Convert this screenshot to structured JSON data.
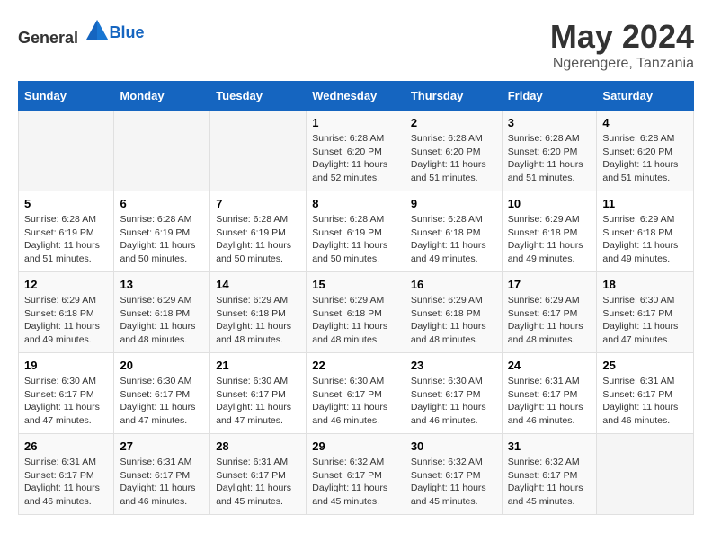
{
  "header": {
    "logo_general": "General",
    "logo_blue": "Blue",
    "title": "May 2024",
    "subtitle": "Ngerengere, Tanzania"
  },
  "days_of_week": [
    "Sunday",
    "Monday",
    "Tuesday",
    "Wednesday",
    "Thursday",
    "Friday",
    "Saturday"
  ],
  "weeks": [
    [
      {
        "day": "",
        "info": ""
      },
      {
        "day": "",
        "info": ""
      },
      {
        "day": "",
        "info": ""
      },
      {
        "day": "1",
        "info": "Sunrise: 6:28 AM\nSunset: 6:20 PM\nDaylight: 11 hours and 52 minutes."
      },
      {
        "day": "2",
        "info": "Sunrise: 6:28 AM\nSunset: 6:20 PM\nDaylight: 11 hours and 51 minutes."
      },
      {
        "day": "3",
        "info": "Sunrise: 6:28 AM\nSunset: 6:20 PM\nDaylight: 11 hours and 51 minutes."
      },
      {
        "day": "4",
        "info": "Sunrise: 6:28 AM\nSunset: 6:20 PM\nDaylight: 11 hours and 51 minutes."
      }
    ],
    [
      {
        "day": "5",
        "info": "Sunrise: 6:28 AM\nSunset: 6:19 PM\nDaylight: 11 hours and 51 minutes."
      },
      {
        "day": "6",
        "info": "Sunrise: 6:28 AM\nSunset: 6:19 PM\nDaylight: 11 hours and 50 minutes."
      },
      {
        "day": "7",
        "info": "Sunrise: 6:28 AM\nSunset: 6:19 PM\nDaylight: 11 hours and 50 minutes."
      },
      {
        "day": "8",
        "info": "Sunrise: 6:28 AM\nSunset: 6:19 PM\nDaylight: 11 hours and 50 minutes."
      },
      {
        "day": "9",
        "info": "Sunrise: 6:28 AM\nSunset: 6:18 PM\nDaylight: 11 hours and 49 minutes."
      },
      {
        "day": "10",
        "info": "Sunrise: 6:29 AM\nSunset: 6:18 PM\nDaylight: 11 hours and 49 minutes."
      },
      {
        "day": "11",
        "info": "Sunrise: 6:29 AM\nSunset: 6:18 PM\nDaylight: 11 hours and 49 minutes."
      }
    ],
    [
      {
        "day": "12",
        "info": "Sunrise: 6:29 AM\nSunset: 6:18 PM\nDaylight: 11 hours and 49 minutes."
      },
      {
        "day": "13",
        "info": "Sunrise: 6:29 AM\nSunset: 6:18 PM\nDaylight: 11 hours and 48 minutes."
      },
      {
        "day": "14",
        "info": "Sunrise: 6:29 AM\nSunset: 6:18 PM\nDaylight: 11 hours and 48 minutes."
      },
      {
        "day": "15",
        "info": "Sunrise: 6:29 AM\nSunset: 6:18 PM\nDaylight: 11 hours and 48 minutes."
      },
      {
        "day": "16",
        "info": "Sunrise: 6:29 AM\nSunset: 6:18 PM\nDaylight: 11 hours and 48 minutes."
      },
      {
        "day": "17",
        "info": "Sunrise: 6:29 AM\nSunset: 6:17 PM\nDaylight: 11 hours and 48 minutes."
      },
      {
        "day": "18",
        "info": "Sunrise: 6:30 AM\nSunset: 6:17 PM\nDaylight: 11 hours and 47 minutes."
      }
    ],
    [
      {
        "day": "19",
        "info": "Sunrise: 6:30 AM\nSunset: 6:17 PM\nDaylight: 11 hours and 47 minutes."
      },
      {
        "day": "20",
        "info": "Sunrise: 6:30 AM\nSunset: 6:17 PM\nDaylight: 11 hours and 47 minutes."
      },
      {
        "day": "21",
        "info": "Sunrise: 6:30 AM\nSunset: 6:17 PM\nDaylight: 11 hours and 47 minutes."
      },
      {
        "day": "22",
        "info": "Sunrise: 6:30 AM\nSunset: 6:17 PM\nDaylight: 11 hours and 46 minutes."
      },
      {
        "day": "23",
        "info": "Sunrise: 6:30 AM\nSunset: 6:17 PM\nDaylight: 11 hours and 46 minutes."
      },
      {
        "day": "24",
        "info": "Sunrise: 6:31 AM\nSunset: 6:17 PM\nDaylight: 11 hours and 46 minutes."
      },
      {
        "day": "25",
        "info": "Sunrise: 6:31 AM\nSunset: 6:17 PM\nDaylight: 11 hours and 46 minutes."
      }
    ],
    [
      {
        "day": "26",
        "info": "Sunrise: 6:31 AM\nSunset: 6:17 PM\nDaylight: 11 hours and 46 minutes."
      },
      {
        "day": "27",
        "info": "Sunrise: 6:31 AM\nSunset: 6:17 PM\nDaylight: 11 hours and 46 minutes."
      },
      {
        "day": "28",
        "info": "Sunrise: 6:31 AM\nSunset: 6:17 PM\nDaylight: 11 hours and 45 minutes."
      },
      {
        "day": "29",
        "info": "Sunrise: 6:32 AM\nSunset: 6:17 PM\nDaylight: 11 hours and 45 minutes."
      },
      {
        "day": "30",
        "info": "Sunrise: 6:32 AM\nSunset: 6:17 PM\nDaylight: 11 hours and 45 minutes."
      },
      {
        "day": "31",
        "info": "Sunrise: 6:32 AM\nSunset: 6:17 PM\nDaylight: 11 hours and 45 minutes."
      },
      {
        "day": "",
        "info": ""
      }
    ]
  ]
}
